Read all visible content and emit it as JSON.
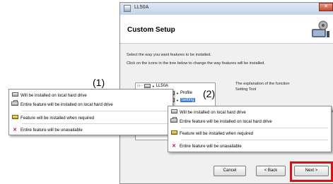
{
  "window": {
    "title": "LL50A",
    "close_glyph": "✕"
  },
  "header": {
    "title": "Custom Setup"
  },
  "instructions": [
    "Select the way you want features to be installed.",
    "Click on the icons in the tree below to change the way features will be installed."
  ],
  "tree": {
    "root_label": "LL50A",
    "children": [
      "Profile",
      "Setting"
    ],
    "selected": "Setting"
  },
  "explanation": {
    "line1": "The explanation of the function",
    "line2": "Setting Tool",
    "partial": "ur"
  },
  "menu_items": [
    {
      "icon": "local-drive-icon",
      "label": "Will be installed on local hard drive"
    },
    {
      "icon": "entire-feature-drive-icon",
      "label": "Entire feature will be installed on local hard drive"
    },
    {
      "icon": "install-on-demand-icon",
      "label": "Feature will be installed when required"
    },
    {
      "icon": "unavailable-x-icon",
      "label": "Entire feature will be unavailable"
    }
  ],
  "callouts": {
    "one": "(1)",
    "two": "(2)"
  },
  "buttons": {
    "cancel": "Cancel",
    "back": "< Back",
    "next": "Next >"
  },
  "colors": {
    "highlight": "#d0141a",
    "selection": "#3b78d8",
    "x_icon": "#c8102e"
  }
}
